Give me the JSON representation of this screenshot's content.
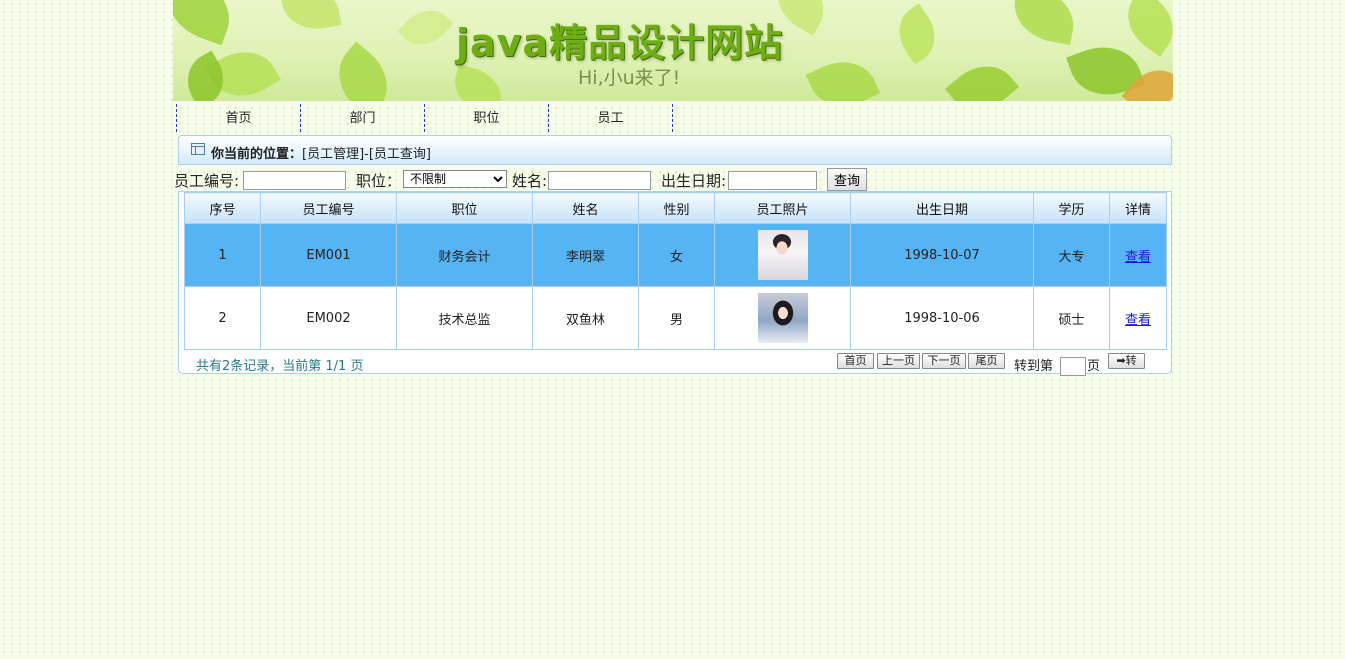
{
  "banner": {
    "title": "java精品设计网站",
    "subtitle": "Hi,小u来了!"
  },
  "nav": [
    "首页",
    "部门",
    "职位",
    "员工"
  ],
  "location": {
    "label": "你当前的位置：",
    "path": "[员工管理]-[员工查询]"
  },
  "search": {
    "emp_no_label": "员工编号:",
    "emp_no_value": "",
    "position_label": "职位：",
    "position_selected": "不限制",
    "name_label": "姓名:",
    "name_value": "",
    "birth_label": "出生日期:",
    "birth_value": "",
    "query_button": "查询"
  },
  "table": {
    "headers": [
      "序号",
      "员工编号",
      "职位",
      "姓名",
      "性别",
      "员工照片",
      "出生日期",
      "学历",
      "详情"
    ],
    "rows": [
      {
        "seq": "1",
        "emp_no": "EM001",
        "position": "财务会计",
        "name": "李明翠",
        "gender": "女",
        "birth": "1998-10-07",
        "education": "大专",
        "detail": "查看"
      },
      {
        "seq": "2",
        "emp_no": "EM002",
        "position": "技术总监",
        "name": "双鱼林",
        "gender": "男",
        "birth": "1998-10-06",
        "education": "硕士",
        "detail": "查看"
      }
    ]
  },
  "pager": {
    "info": "共有2条记录，当前第 1/1 页",
    "first": "首页",
    "prev": "上一页",
    "next": "下一页",
    "last": "尾页",
    "goto_label": "转到第",
    "goto_value": "",
    "page_unit": "页",
    "goto_button": "➡转"
  },
  "colors": {
    "selected_row": "#55b4f3",
    "header_gradient_end": "#c8e2f8",
    "banner_green": "#6fae12"
  }
}
